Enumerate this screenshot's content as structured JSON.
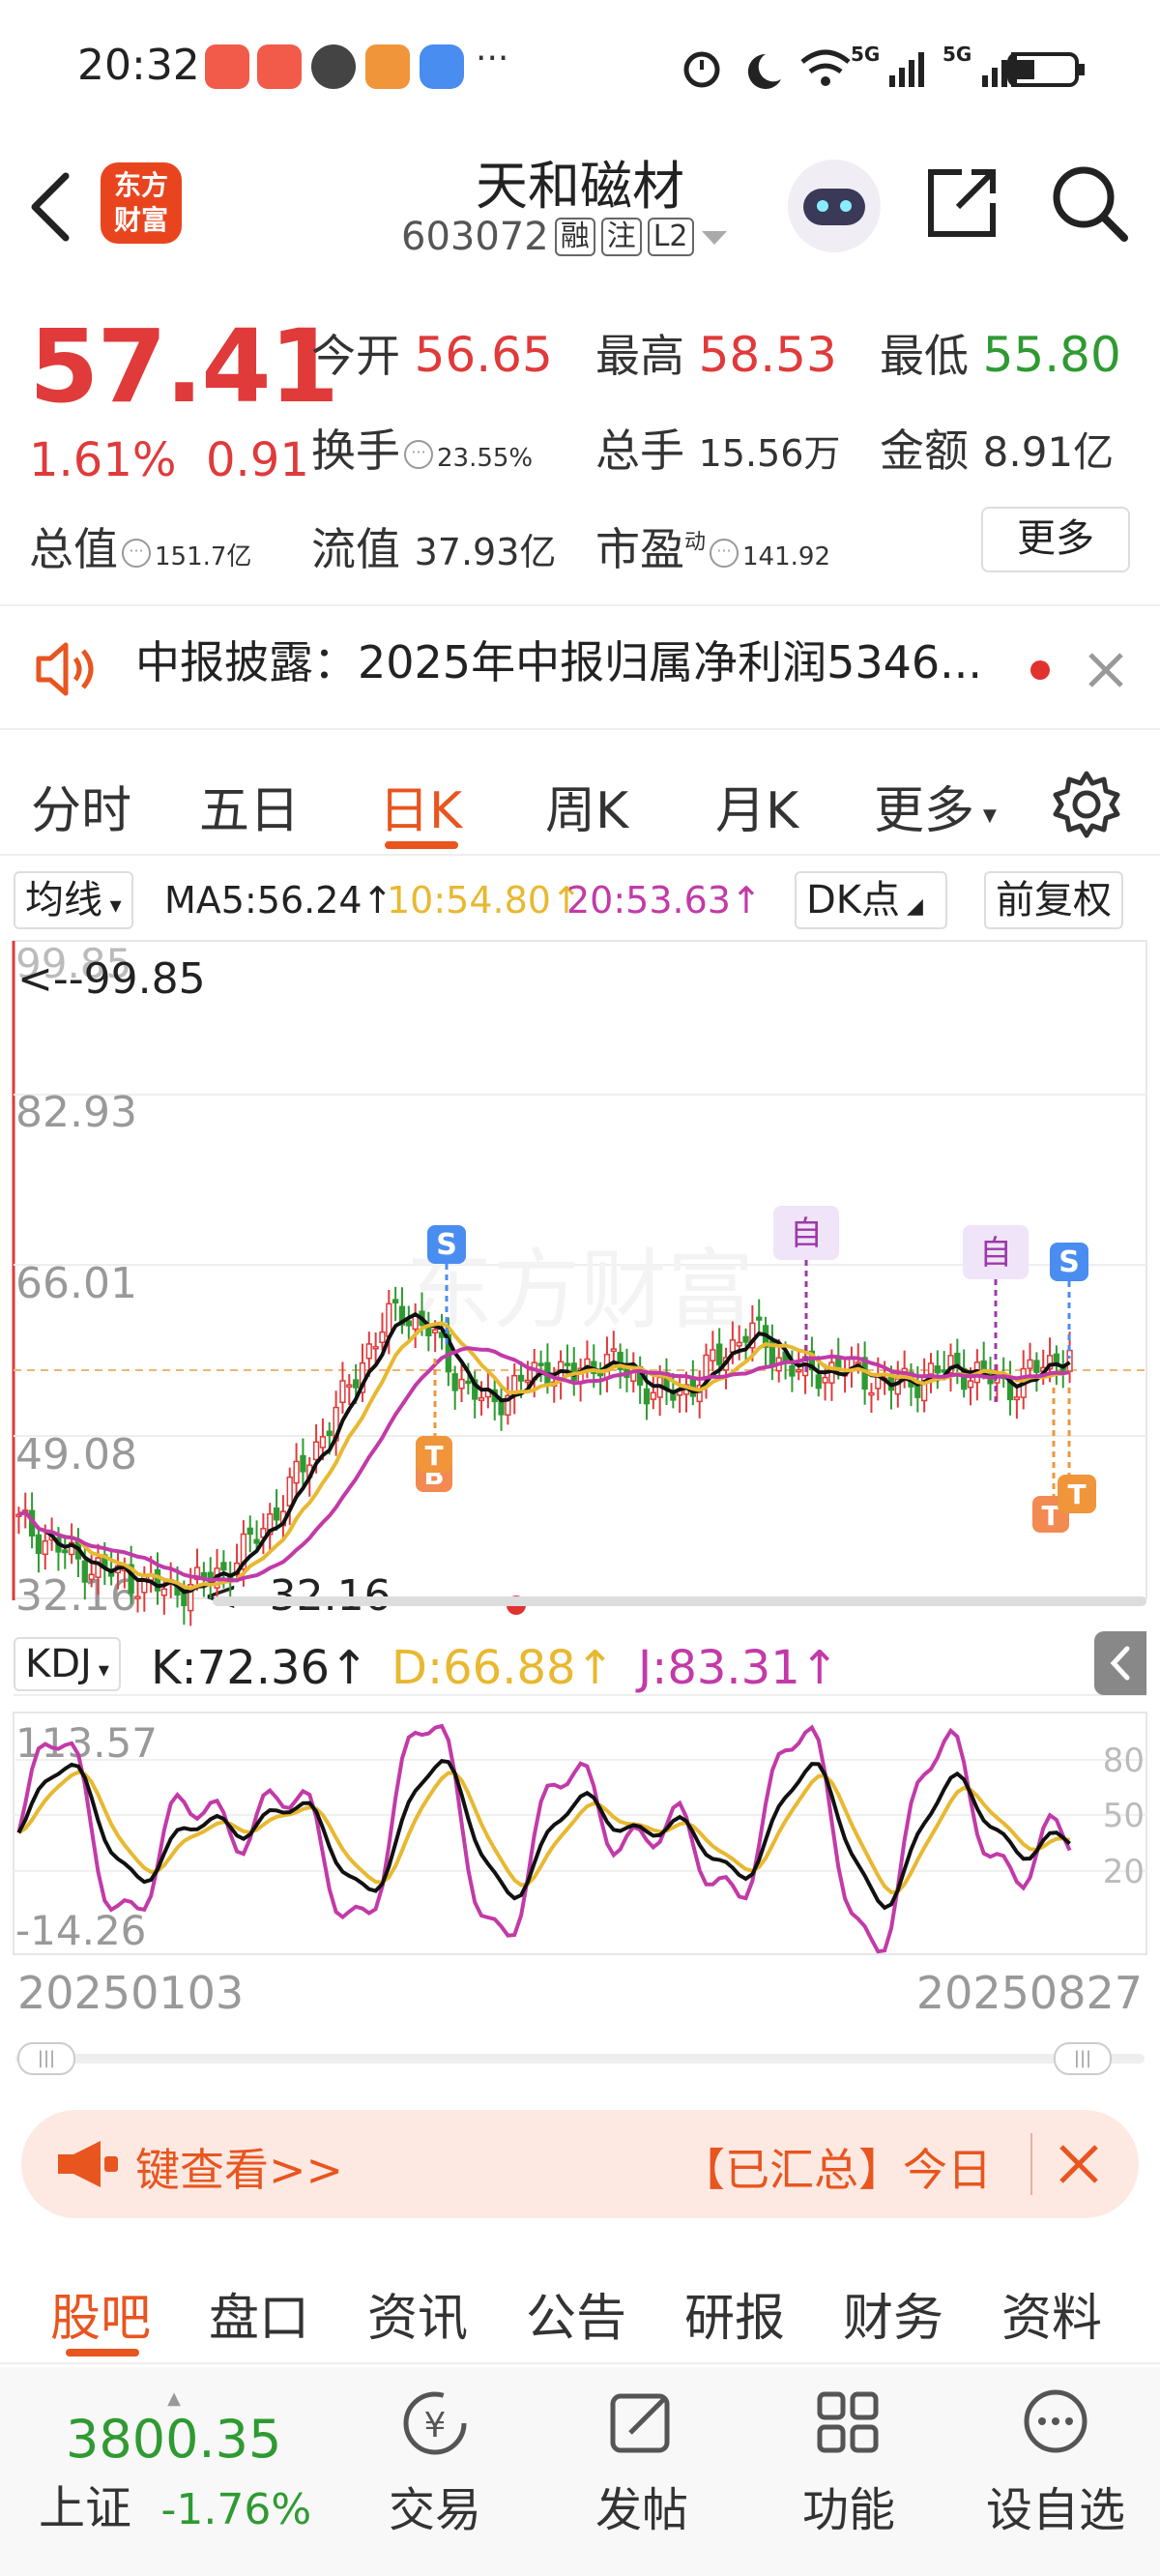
{
  "status_bar": {
    "time": "20:32",
    "net1": "5G",
    "net2": "5G"
  },
  "header": {
    "logo_line1": "东方",
    "logo_line2": "财富",
    "stock_name": "天和磁材",
    "code": "603072",
    "tag1": "融",
    "tag2": "注",
    "tag3": "L2"
  },
  "quote": {
    "price": "57.41",
    "change_pct": "1.61%",
    "change_abs": "0.91",
    "open_label": "今开",
    "open": "56.65",
    "high_label": "最高",
    "high": "58.53",
    "low_label": "最低",
    "low": "55.80",
    "turnover_label": "换手",
    "turnover": "23.55%",
    "volume_label": "总手",
    "volume": "15.56万",
    "amount_label": "金额",
    "amount": "8.91亿",
    "mktcap_label": "总值",
    "mktcap": "151.7亿",
    "float_label": "流值",
    "float": "37.93亿",
    "pe_label": "市盈",
    "pe_sup": "动",
    "pe": "141.92",
    "more_label": "更多"
  },
  "news": {
    "text": "中报披露：2025年中报归属净利润5346..."
  },
  "tabs": [
    "分时",
    "五日",
    "日K",
    "周K",
    "月K",
    "更多"
  ],
  "active_tab": "日K",
  "ma_bar": {
    "select_label": "均线",
    "ma5": "MA5:56.24↑",
    "ma10": "10:54.80↑",
    "ma20": "20:53.63↑",
    "dk_label": "DK点",
    "adjust_label": "前复权"
  },
  "kline": {
    "y_max": "99.85",
    "y_max_marker": "<--99.85",
    "y_ticks": [
      "82.93",
      "66.01",
      "49.08"
    ],
    "y_min": "32.16",
    "y_min_marker": "<--32.16",
    "marker_s": "S",
    "marker_zi": "自",
    "marker_t": "T",
    "marker_b": "B",
    "watermark": "东方财富"
  },
  "kdj": {
    "select_label": "KDJ",
    "k": "K:72.36↑",
    "d": "D:66.88↑",
    "j": "J:83.31↑",
    "y_max": "113.57",
    "y_min": "-14.26",
    "levels": [
      "80",
      "50",
      "20"
    ],
    "date_start": "20250103",
    "date_end": "20250827"
  },
  "banner": {
    "left_text": "键查看>>",
    "right_text": "【已汇总】今日"
  },
  "bottom_tabs": [
    "股吧",
    "盘口",
    "资讯",
    "公告",
    "研报",
    "财务",
    "资料"
  ],
  "active_bottom_tab": "股吧",
  "bottom_nav": {
    "index_value": "3800.35",
    "index_name": "上证",
    "index_change": "-1.76%",
    "items": [
      "交易",
      "发帖",
      "功能",
      "设自选"
    ]
  },
  "colors": {
    "up": "#e03a3a",
    "down": "#2f9a32",
    "accent": "#e8551f",
    "ma10": "#e8b830",
    "ma20": "#c23aa8"
  },
  "chart_data": [
    {
      "type": "candlestick",
      "title": "日K",
      "x_range": [
        "20250103",
        "20250827"
      ],
      "ylim": [
        32.16,
        99.85
      ],
      "y_ticks": [
        82.93,
        66.01,
        49.08
      ],
      "close_series": [
        40,
        38,
        36,
        35,
        34,
        33,
        33.5,
        35,
        38,
        42,
        47,
        52,
        58,
        62,
        60,
        55,
        52,
        54,
        56,
        55,
        57,
        55,
        53,
        54,
        57,
        60,
        57,
        55,
        56,
        55,
        54,
        55,
        56,
        55,
        54,
        56,
        57.41
      ],
      "ma5_last": 56.24,
      "ma10_last": 54.8,
      "ma20_last": 53.63
    },
    {
      "type": "line",
      "title": "KDJ",
      "ylim": [
        -14.26,
        113.57
      ],
      "levels": [
        80,
        50,
        20
      ],
      "series": [
        {
          "name": "K",
          "last": 72.36
        },
        {
          "name": "D",
          "last": 66.88
        },
        {
          "name": "J",
          "last": 83.31
        }
      ]
    }
  ]
}
